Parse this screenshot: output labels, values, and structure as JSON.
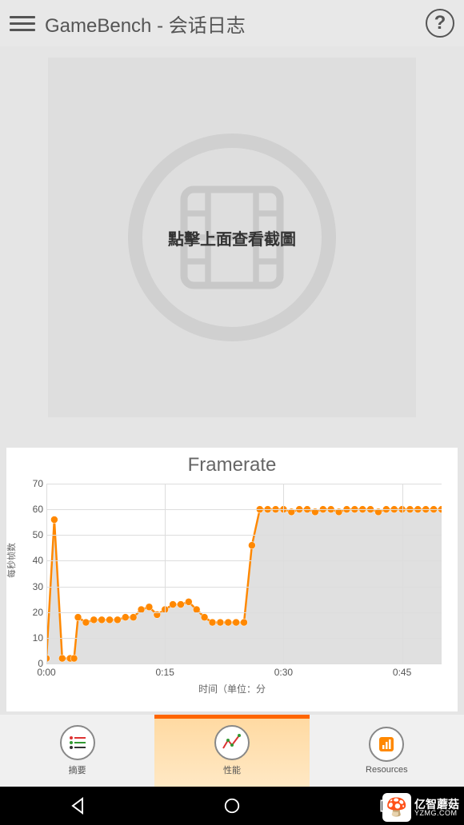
{
  "header": {
    "title": "GameBench - 会话日志"
  },
  "screenshot": {
    "hint": "點擊上面查看截圖"
  },
  "chart_data": {
    "type": "line",
    "title": "Framerate",
    "xlabel": "时间（单位：分",
    "ylabel": "每秒帧数",
    "ylim": [
      0,
      70
    ],
    "xlim": [
      0,
      50
    ],
    "yticks": [
      0,
      10,
      20,
      30,
      40,
      50,
      60,
      70
    ],
    "xticks": [
      "0:00",
      "0:15",
      "0:30",
      "0:45"
    ],
    "xtick_positions": [
      0,
      15,
      30,
      45
    ],
    "x": [
      0,
      1,
      2,
      3,
      3.5,
      4,
      5,
      6,
      7,
      8,
      9,
      10,
      11,
      12,
      13,
      14,
      15,
      16,
      17,
      18,
      19,
      20,
      21,
      22,
      23,
      24,
      25,
      26,
      27,
      28,
      29,
      30,
      31,
      32,
      33,
      34,
      35,
      36,
      37,
      38,
      39,
      40,
      41,
      42,
      43,
      44,
      45,
      46,
      47,
      48,
      49,
      50
    ],
    "values": [
      2,
      56,
      2,
      2,
      2,
      18,
      16,
      17,
      17,
      17,
      17,
      18,
      18,
      21,
      22,
      19,
      21,
      23,
      23,
      24,
      21,
      18,
      16,
      16,
      16,
      16,
      16,
      46,
      60,
      60,
      60,
      60,
      59,
      60,
      60,
      59,
      60,
      60,
      59,
      60,
      60,
      60,
      60,
      59,
      60,
      60,
      60,
      60,
      60,
      60,
      60,
      60
    ],
    "series_color": "#ff8800"
  },
  "tabs": {
    "tab1": "摘要",
    "tab2": "性能",
    "tab3": "Resources"
  },
  "watermark": {
    "brand": "亿智蘑菇",
    "url": "YZMG.COM"
  }
}
